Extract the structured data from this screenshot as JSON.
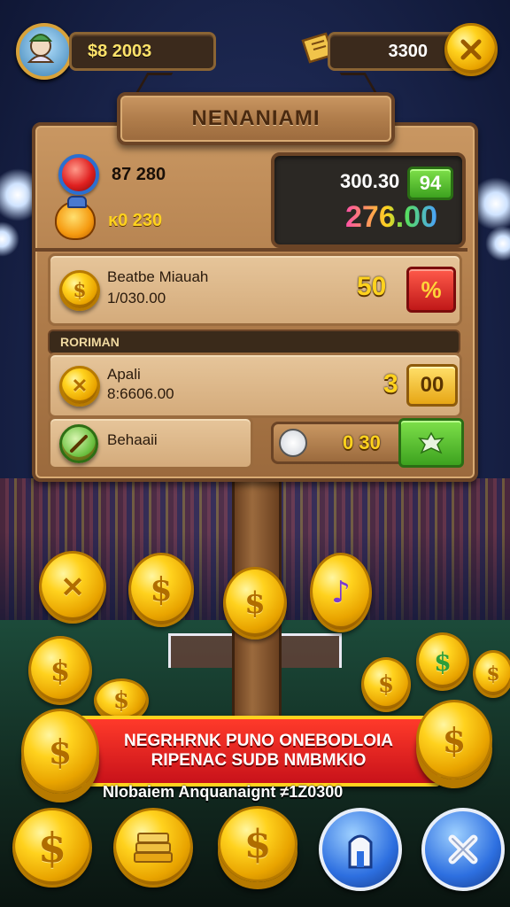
{
  "hud": {
    "left_value": "$8 2003",
    "right_value": "3300",
    "avatar_icon": "player-avatar-icon",
    "ticket_icon": "ticket-icon",
    "close_icon": "gold-cross-button-icon"
  },
  "sign": {
    "title": "NENANIAMI"
  },
  "stats": {
    "row1_value": "87 280",
    "row1_icon": "red-gem-icon",
    "row2_value": "ĸ0 230",
    "row2_icon": "orange-mascot-icon",
    "display_value": "300.30",
    "display_badge": "94",
    "display_big": "276.00"
  },
  "offer1": {
    "title": "Beatbe Miauah",
    "subtitle": "1/030.00",
    "amount": "50",
    "button_label": "%"
  },
  "section_label": "RORIMAN",
  "offer2": {
    "title": "Apali",
    "subtitle": "8:6606.00",
    "amount": "3",
    "button_label": "00"
  },
  "offer3": {
    "title": "Behaaii",
    "counter": "0 30",
    "button_icon": "star-burst-icon"
  },
  "banner": {
    "line1": "NEGRHRNK PUNO ONEBODLOIA",
    "line2": "RIPENAC SUDB NMBMKIO",
    "caption": "Nlobaiem Anquanaignt ≠1Z0300"
  },
  "bottom_bar": {
    "items": [
      "coin-button-icon",
      "gold-bars-icon",
      "coin-stack-icon",
      "info-button-icon",
      "close-button-icon"
    ]
  },
  "colors": {
    "accent_gold": "#ffd21e",
    "banner_red": "#d8171b",
    "green": "#3da21f",
    "blue": "#2d6fe0"
  }
}
